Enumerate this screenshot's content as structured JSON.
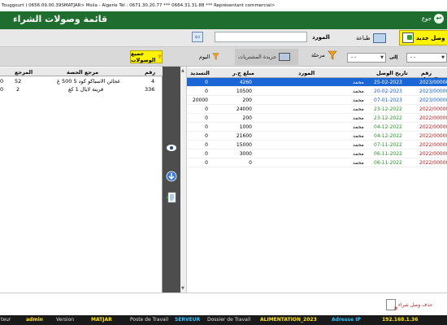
{
  "window": {
    "title_text": "Touggourt )  0656.09.00.39SMATJAR>  Msila - Algerie Tél : 0671.30.20.77  ***  0664.31.31.88  ***  Représentant commercial>"
  },
  "header": {
    "page_title": "قائمة وصولات الشراء",
    "back_label": "جوع"
  },
  "toolbar": {
    "new_receipt_label": "وصل جديد",
    "print_label": "طباعة",
    "supplier_label": "المورد",
    "supplier_value": ""
  },
  "filters": {
    "from_label": "من",
    "from_value": "-  -",
    "to_label": "إلى",
    "to_value": "-  -",
    "stage_label": "مرحلة",
    "purchases_label": "جريدة المشتريات",
    "today_label": "اليوم",
    "all_receipts_label": "جميع الوصولات"
  },
  "left_table": {
    "columns": [
      "رقم",
      "مرجع الحصة",
      "المرجع",
      ""
    ],
    "rows": [
      {
        "num": "4",
        "ref": "عجائن الاسباكو كود 5 500 غ",
        "code": "52",
        "x": "0"
      },
      {
        "num": "336",
        "ref": "قرينة لايال 1 كغ",
        "code": "2",
        "x": "0"
      }
    ]
  },
  "right_table": {
    "columns": [
      "رقم الوصل",
      "تاريخ الوصل",
      "المورد",
      "مبلغ ج.ر",
      "التسديد"
    ],
    "rows": [
      {
        "num": "2023/00000",
        "date": "25-02-2023",
        "supplier": "محمد",
        "amount": "4260",
        "paid": "0",
        "selected": true
      },
      {
        "num": "2023/00000",
        "date": "20-02-2023",
        "supplier": "محمد",
        "amount": "10500",
        "paid": "0",
        "selected": false
      },
      {
        "num": "2023/00000",
        "date": "07-01-2023",
        "supplier": "محمد",
        "amount": "200",
        "paid": "20000",
        "selected": false
      },
      {
        "num": "2022/00000",
        "date": "23-12-2022",
        "supplier": "محمد",
        "amount": "24000",
        "paid": "0",
        "selected": false
      },
      {
        "num": "2022/00000",
        "date": "23-12-2022",
        "supplier": "محمد",
        "amount": "200",
        "paid": "0",
        "selected": false
      },
      {
        "num": "2022/00000",
        "date": "04-12-2022",
        "supplier": "محمد",
        "amount": "1000",
        "paid": "0",
        "selected": false
      },
      {
        "num": "2022/00000",
        "date": "04-12-2022",
        "supplier": "محمد",
        "amount": "21600",
        "paid": "0",
        "selected": false
      },
      {
        "num": "2022/00000",
        "date": "07-11-2022",
        "supplier": "محمد",
        "amount": "15000",
        "paid": "0",
        "selected": false
      },
      {
        "num": "2022/00000",
        "date": "06-11-2022",
        "supplier": "محمد",
        "amount": "3000",
        "paid": "0",
        "selected": false
      },
      {
        "num": "2022/00000",
        "date": "06-11-2022",
        "supplier": "محمد",
        "amount": "0",
        "paid": "0",
        "selected": false
      }
    ]
  },
  "bottom": {
    "cancel_label": "حذف وصل شراء"
  },
  "statusbar": {
    "user_label": "teur",
    "user_value": "admin",
    "version_label": "Version",
    "version_value": "MATJAR",
    "workstation_label": "Poste de Travail",
    "workstation_value": "SERVEUR",
    "folder_label": "Dossier de Travail",
    "folder_value": "ALIMENTATION_2023",
    "ip_label": "Adresse IP",
    "ip_value": "192.168.1.36"
  },
  "colors": {
    "header_green": "#1f6e2f",
    "button_yellow": "#fff300",
    "selected_row": "#1a66d6",
    "status_yellow": "#ffe600",
    "status_cyan": "#2ec4ff"
  }
}
